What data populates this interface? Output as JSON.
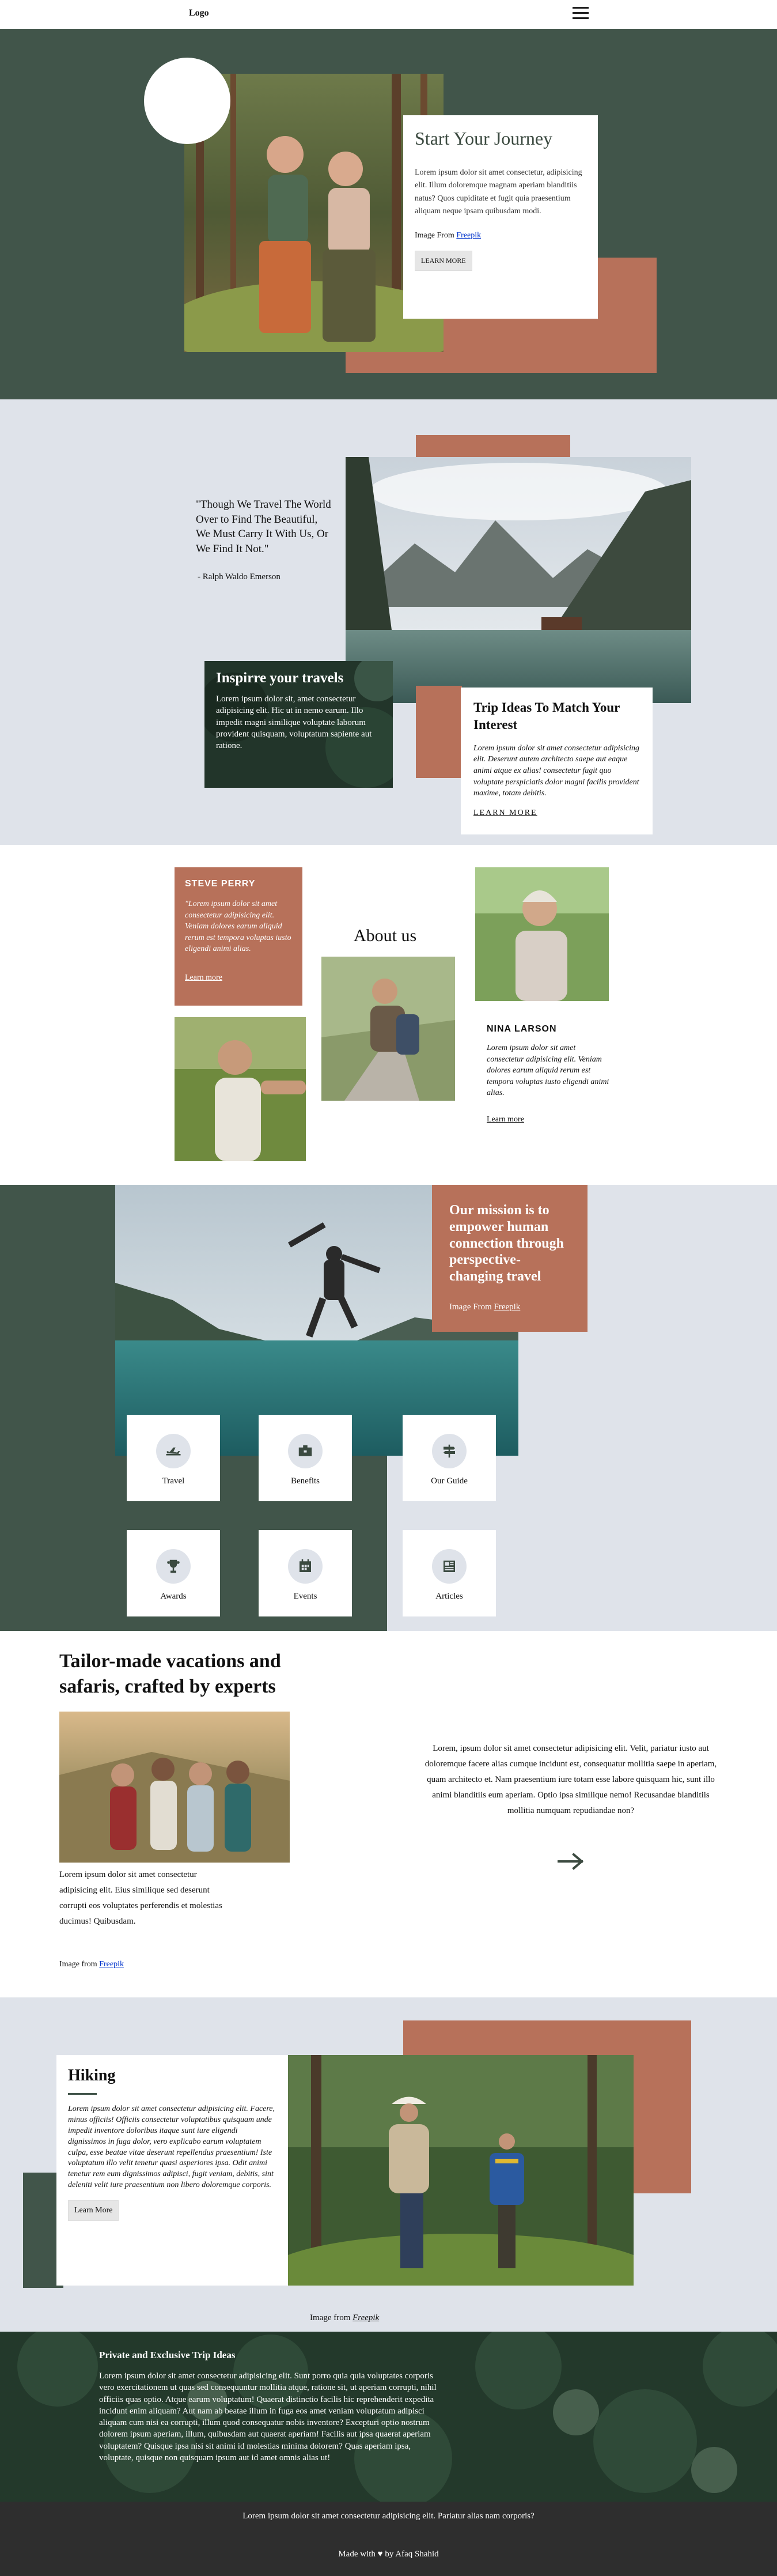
{
  "header": {
    "logo": "Logo",
    "menu_icon": "hamburger-menu-icon"
  },
  "hero": {
    "title": "Start Your Journey",
    "text": "Lorem ipsum dolor sit amet consectetur, adipisicing elit. Illum doloremque magnam aperiam blanditiis natus? Quos cupiditate et fugit quia praesentium aliquam neque ipsam quibusdam modi.",
    "credit_prefix": "Image From",
    "credit_link": "Freepik",
    "button": "LEARN MORE"
  },
  "inspire": {
    "quote": "\"Though We Travel The World Over to Find The Beautiful, We Must Carry It With Us, Or We Find It Not.\"",
    "author": "- Ralph Waldo Emerson",
    "green_title": "Inspirre your travels",
    "green_text": "Lorem ipsum dolor sit, amet consectetur adipisicing elit. Hic ut in nemo earum. Illo impedit magni similique voluptate laborum provident quisquam, voluptatum sapiente aut ratione.",
    "card_title": "Trip Ideas To Match Your Interest",
    "card_text": "Lorem ipsum dolor sit amet consectetur adipisicing elit. Deserunt autem architecto saepe aut eaque animi atque ex alias! consectetur fugit quo voluptate perspiciatis dolor magni facilis provident maxime, totam debitis.",
    "card_link": "LEARN MORE"
  },
  "about": {
    "title": "About us",
    "steve": {
      "name": "STEVE PERRY",
      "text": "\"Lorem ipsum dolor sit amet consectetur adipisicing elit. Veniam dolores earum aliquid rerum est tempora voluptas iusto eligendi animi alias.",
      "link": "Learn more"
    },
    "nina": {
      "name": "NINA LARSON",
      "text": "Lorem ipsum dolor sit amet consectetur adipisicing elit. Veniam dolores earum aliquid rerum est tempora voluptas iusto eligendi animi alias.",
      "link": "Learn more"
    }
  },
  "mission": {
    "title": "Our mission is to empower human connection through perspective-changing travel",
    "credit_prefix": "Image From",
    "credit_link": "Freepik",
    "tiles": [
      {
        "label": "Travel",
        "icon": "airplane-icon"
      },
      {
        "label": "Benefits",
        "icon": "briefcase-icon"
      },
      {
        "label": "Our Guide",
        "icon": "signpost-icon"
      },
      {
        "label": "Awards",
        "icon": "trophy-icon"
      },
      {
        "label": "Events",
        "icon": "calendar-icon"
      },
      {
        "label": "Articles",
        "icon": "newspaper-icon"
      }
    ]
  },
  "tailor": {
    "title": "Tailor-made vacations and safaris, crafted by experts",
    "text": "Lorem ipsum dolor sit amet consectetur adipisicing elit. Eius similique sed deserunt corrupti eos voluptates perferendis et molestias ducimus! Quibusdam.",
    "credit_prefix": "Image from",
    "credit_link": "Freepik",
    "right_text": "Lorem, ipsum dolor sit amet consectetur adipisicing elit. Velit, pariatur iusto aut doloremque facere alias cumque incidunt est, consequatur mollitia saepe in aperiam, quam architecto et. Nam praesentium iure totam esse labore quisquam hic, sunt illo animi blanditiis eum aperiam. Optio ipsa similique nemo! Recusandae blanditiis mollitia numquam repudiandae non?",
    "arrow_icon": "arrow-right-icon"
  },
  "hiking": {
    "title": "Hiking",
    "text": "Lorem ipsum dolor sit amet consectetur adipisicing elit. Facere, minus officiis! Officiis consectetur voluptatibus quisquam unde impedit inventore doloribus itaque sunt iure eligendi dignissimos in fuga dolor, vero explicabo earum voluptatem culpa, esse beatae vitae deserunt repellendus praesentium! Iste voluptatum illo velit tenetur quasi asperiores ipsa. Odit animi tenetur rem eum dignissimos adipisci, fugit veniam, debitis, sint deleniti velit iure praesentium non libero doloremque corporis.",
    "button": "Learn More",
    "credit_prefix": "Image from",
    "credit_link": "Freepik"
  },
  "private": {
    "title": "Private and Exclusive Trip Ideas",
    "text": "Lorem ipsum dolor sit amet consectetur adipisicing elit. Sunt porro quia quia voluptates corporis vero exercitationem ut quas sed consequuntur mollitia atque, ratione sit, ut aperiam corrupti, nihil officiis quas optio. Atque earum voluptatum! Quaerat distinctio facilis hic reprehenderit expedita incidunt enim aliquam? Aut nam ab beatae illum in fuga eos amet veniam voluptatum adipisci aliquam cum nisi ea corrupti, illum quod consequatur nobis inventore? Excepturi optio nostrum dolorem ipsum aperiam, illum, quibusdam aut quaerat aperiam! Facilis aut ipsa quaerat aperiam voluptatem? Quisque ipsa nisi sit animi id molestias minima dolorem? Quas aperiam ipsa, voluptate, quisque non quisquam ipsum aut id amet omnis alias ut!"
  },
  "footer": {
    "text": "Lorem ipsum dolor sit amet consectetur adipisicing elit. Pariatur alias nam corporis?",
    "made_prefix": "Made with",
    "heart": "♥",
    "made_suffix": "by  Afaq Shahid"
  }
}
